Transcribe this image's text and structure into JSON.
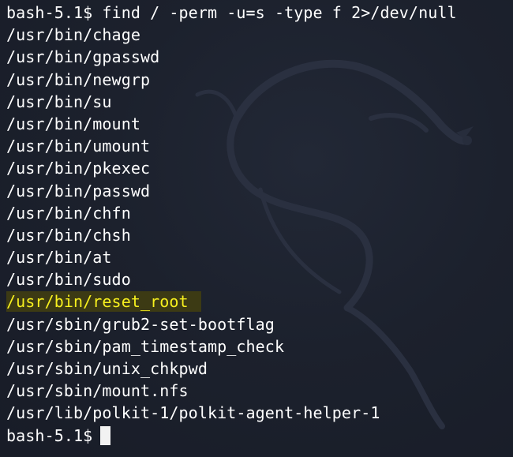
{
  "terminal": {
    "command_line": "bash-5.1$ find / -perm -u=s -type f 2>/dev/null",
    "output": [
      "/usr/bin/chage",
      "/usr/bin/gpasswd",
      "/usr/bin/newgrp",
      "/usr/bin/su",
      "/usr/bin/mount",
      "/usr/bin/umount",
      "/usr/bin/pkexec",
      "/usr/bin/passwd",
      "/usr/bin/chfn",
      "/usr/bin/chsh",
      "/usr/bin/at",
      "/usr/bin/sudo",
      "/usr/bin/reset_root",
      "/usr/sbin/grub2-set-bootflag",
      "/usr/sbin/pam_timestamp_check",
      "/usr/sbin/unix_chkpwd",
      "/usr/sbin/mount.nfs",
      "/usr/lib/polkit-1/polkit-agent-helper-1"
    ],
    "prompt": "bash-5.1$",
    "highlight_color": "#f7f01e",
    "highlight_background": "#3c3a14",
    "background_icon": "kali-dragon-icon"
  }
}
